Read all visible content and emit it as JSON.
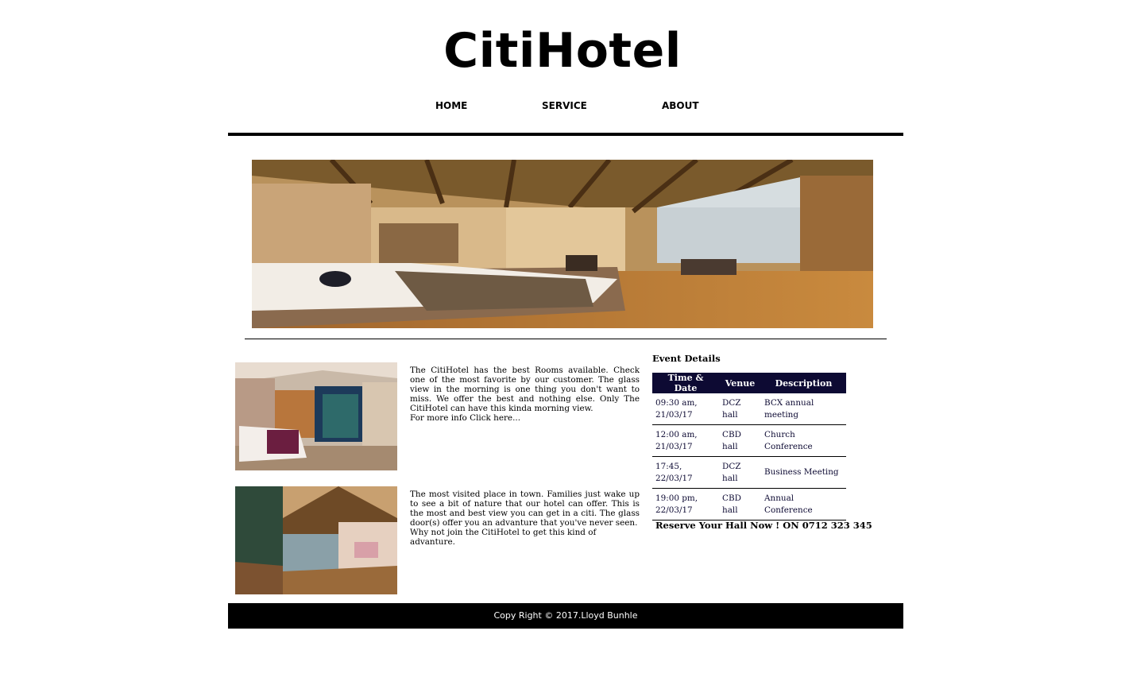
{
  "header": {
    "title": "CitiHotel"
  },
  "nav": {
    "items": [
      "HOME",
      "SERVICE",
      "ABOUT"
    ]
  },
  "hero": {
    "image": "hotel-room-banner"
  },
  "articles": [
    {
      "image": "bedroom-with-glass-view",
      "text": "The CitiHotel has the best Rooms available. Check one of the most favorite by our customer. The glass view in the morning is one thing you don't want to miss. We offer the best and nothing else. Only The CitiHotel can have this kinda morning view.",
      "link": "For more info Click here..."
    },
    {
      "image": "lodge-deck-view",
      "text": "The most visited place in town. Families just wake up to see a bit of nature that our hotel can offer. This is the most and best view you can get in a citi. The glass door(s) offer you an advanture that you've never seen.",
      "link": "Why not join the CitiHotel to get this kind of advanture."
    }
  ],
  "events": {
    "title": "Event Details",
    "columns": [
      "Time & Date",
      "Venue",
      "Description"
    ],
    "rows": [
      [
        "09:30 am, 21/03/17",
        "DCZ hall",
        "BCX annual meeting"
      ],
      [
        "12:00 am, 21/03/17",
        "CBD hall",
        "Church Conference"
      ],
      [
        "17:45, 22/03/17",
        "DCZ hall",
        "Business Meeting"
      ],
      [
        "19:00 pm, 22/03/17",
        "CBD hall",
        "Annual Conference"
      ]
    ],
    "reserve": "Reserve Your Hall Now ! ON 0712 323 345"
  },
  "footer": {
    "text": "Copy Right © 2017.Lloyd Bunhle"
  },
  "colors": {
    "table_header": "#0d0a33",
    "footer_bg": "#000000"
  }
}
